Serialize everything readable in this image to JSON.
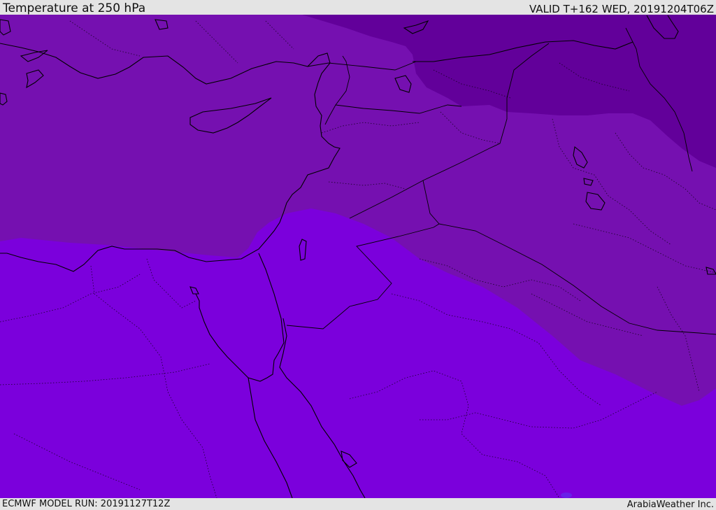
{
  "header": {
    "title": "Temperature at 250 hPa",
    "valid_time": "VALID T+162 WED, 20191204T06Z"
  },
  "footer": {
    "model_run": "ECMWF MODEL RUN: 20191127T12Z",
    "credit": "ArabiaWeather Inc."
  },
  "map": {
    "field": "temperature",
    "level": "250 hPa",
    "colors": {
      "coldest": "#62009a",
      "colder": "#7510b0",
      "cold": "#7b00dc",
      "coastline": "#000000",
      "borders": "#000000"
    }
  }
}
